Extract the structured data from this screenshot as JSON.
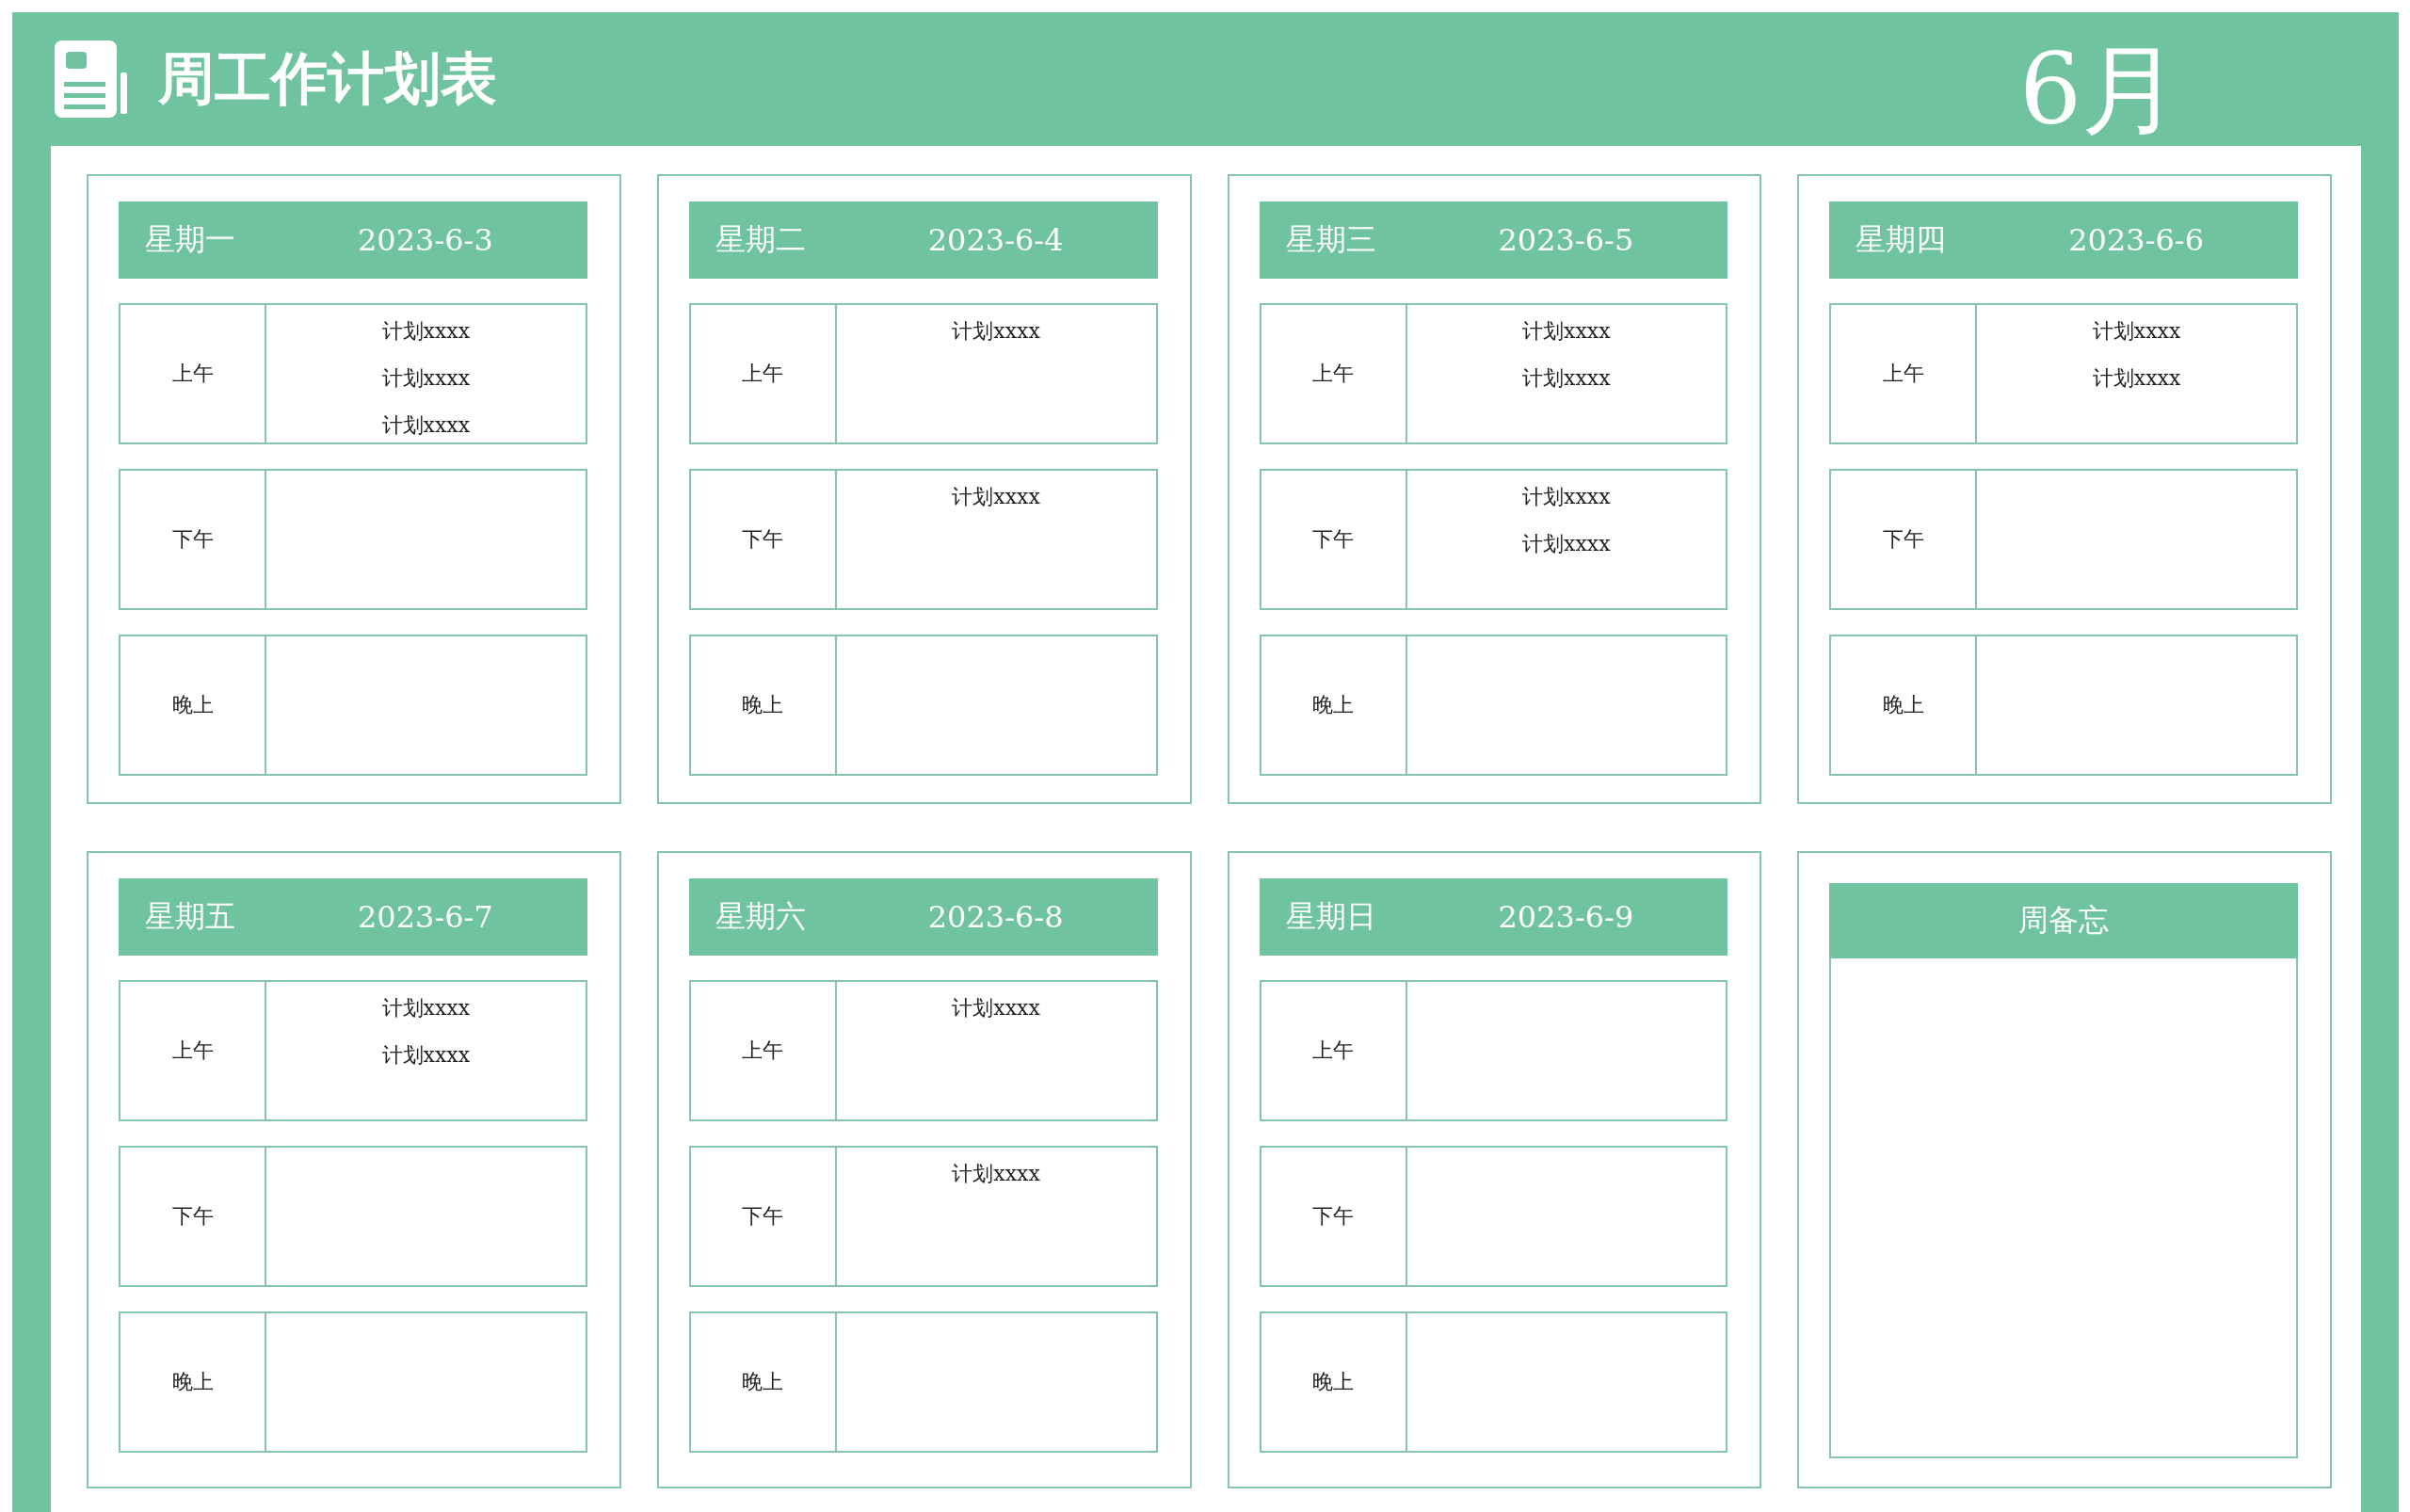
{
  "header": {
    "title": "周工作计划表",
    "month": "6月"
  },
  "days": [
    {
      "weekday": "星期一",
      "date": "2023-6-3",
      "slots": [
        {
          "label": "上午",
          "plans": [
            "计划xxxx",
            "计划xxxx",
            "计划xxxx"
          ]
        },
        {
          "label": "下午"
        },
        {
          "label": "晚上"
        }
      ]
    },
    {
      "weekday": "星期二",
      "date": "2023-6-4",
      "slots": [
        {
          "label": "上午",
          "plans": [
            "计划xxxx"
          ]
        },
        {
          "label": "下午",
          "plans": [
            "计划xxxx"
          ]
        },
        {
          "label": "晚上"
        }
      ]
    },
    {
      "weekday": "星期三",
      "date": "2023-6-5",
      "slots": [
        {
          "label": "上午",
          "plans": [
            "计划xxxx",
            "计划xxxx"
          ]
        },
        {
          "label": "下午",
          "plans": [
            "计划xxxx",
            "计划xxxx"
          ]
        },
        {
          "label": "晚上"
        }
      ]
    },
    {
      "weekday": "星期四",
      "date": "2023-6-6",
      "slots": [
        {
          "label": "上午",
          "plans": [
            "计划xxxx",
            "计划xxxx"
          ]
        },
        {
          "label": "下午"
        },
        {
          "label": "晚上"
        }
      ]
    },
    {
      "weekday": "星期五",
      "date": "2023-6-7",
      "slots": [
        {
          "label": "上午",
          "plans": [
            "计划xxxx",
            "计划xxxx"
          ]
        },
        {
          "label": "下午"
        },
        {
          "label": "晚上"
        }
      ]
    },
    {
      "weekday": "星期六",
      "date": "2023-6-8",
      "slots": [
        {
          "label": "上午",
          "plans": [
            "计划xxxx"
          ]
        },
        {
          "label": "下午",
          "plans": [
            "计划xxxx"
          ]
        },
        {
          "label": "晚上"
        }
      ]
    },
    {
      "weekday": "星期日",
      "date": "2023-6-9",
      "slots": [
        {
          "label": "上午"
        },
        {
          "label": "下午"
        },
        {
          "label": "晚上"
        }
      ]
    }
  ],
  "memo": {
    "title": "周备忘"
  }
}
